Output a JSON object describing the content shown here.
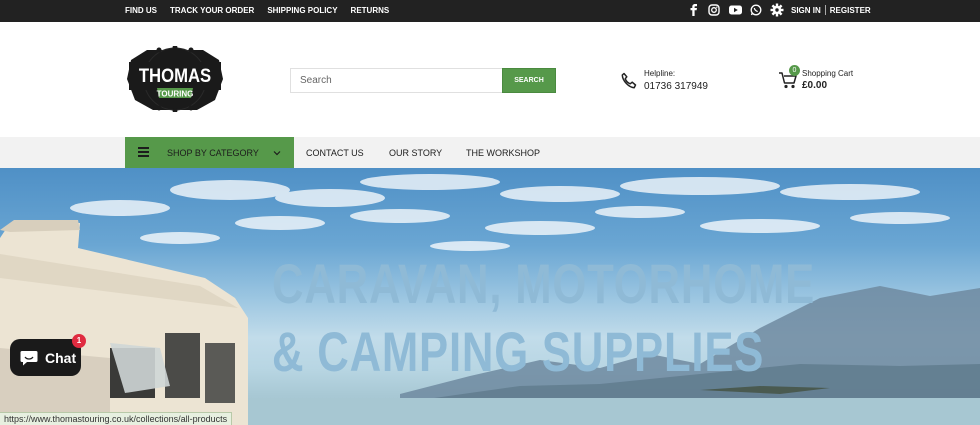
{
  "topbar": {
    "links": [
      "FIND US",
      "TRACK YOUR ORDER",
      "SHIPPING POLICY",
      "RETURNS"
    ],
    "social_icons": [
      "facebook-icon",
      "instagram-icon",
      "youtube-icon",
      "whatsapp-icon"
    ],
    "sign_in": "SIGN IN",
    "register": "REGISTER"
  },
  "logo": {
    "line1": "THOMAS",
    "line2": "TOURING"
  },
  "search": {
    "placeholder": "Search",
    "button": "SEARCH"
  },
  "helpline": {
    "label": "Helpline:",
    "number": "01736 317949"
  },
  "cart": {
    "label": "Shopping Cart",
    "total": "£0.00",
    "count": "0"
  },
  "nav": {
    "category": "SHOP BY CATEGORY",
    "items": [
      "CONTACT US",
      "OUR STORY",
      "THE WORKSHOP"
    ]
  },
  "hero": {
    "line1": "CARAVAN, MOTORHOME",
    "line2": "& CAMPING  SUPPLIES"
  },
  "chat": {
    "label": "Chat",
    "badge": "1"
  },
  "status_bar": {
    "url": "https://www.thomastouring.co.uk/collections/all-products"
  },
  "colors": {
    "accent": "#56994a",
    "topbar": "#222222",
    "hero_text": "#8fbad6",
    "chat_badge": "#e02b40"
  }
}
